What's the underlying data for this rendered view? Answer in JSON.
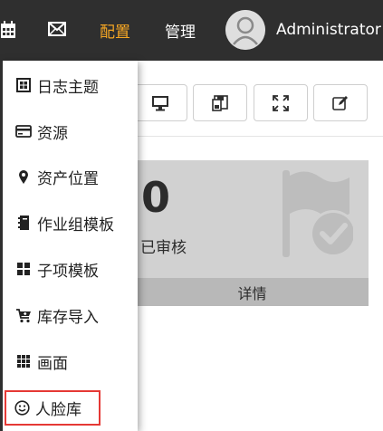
{
  "nav": {
    "items": [
      {
        "icon": "calendar-icon"
      },
      {
        "icon": "mail-icon"
      },
      {
        "label": "配置",
        "active": true
      },
      {
        "label": "管理"
      }
    ],
    "user_name": "Administrator",
    "active_color": "#f5a623"
  },
  "toolbar": {
    "buttons": [
      "monitor-icon",
      "save-icon",
      "fullscreen-icon",
      "edit-icon"
    ]
  },
  "card": {
    "value": "0",
    "label": "已审核",
    "footer": "详情",
    "icon": "flag-check-icon"
  },
  "menu": {
    "items": [
      {
        "label": "日志主题",
        "icon": "grid-box-icon"
      },
      {
        "label": "资源",
        "icon": "credit-card-icon"
      },
      {
        "label": "资产位置",
        "icon": "map-marker-icon"
      },
      {
        "label": "作业组模板",
        "icon": "book-icon"
      },
      {
        "label": "子项模板",
        "icon": "th-large-icon"
      },
      {
        "label": "库存导入",
        "icon": "cart-plus-icon"
      },
      {
        "label": "画面",
        "icon": "th-icon"
      },
      {
        "label": "人脸库",
        "icon": "smile-icon",
        "highlighted": true
      }
    ],
    "highlight_color": "#e53935"
  }
}
